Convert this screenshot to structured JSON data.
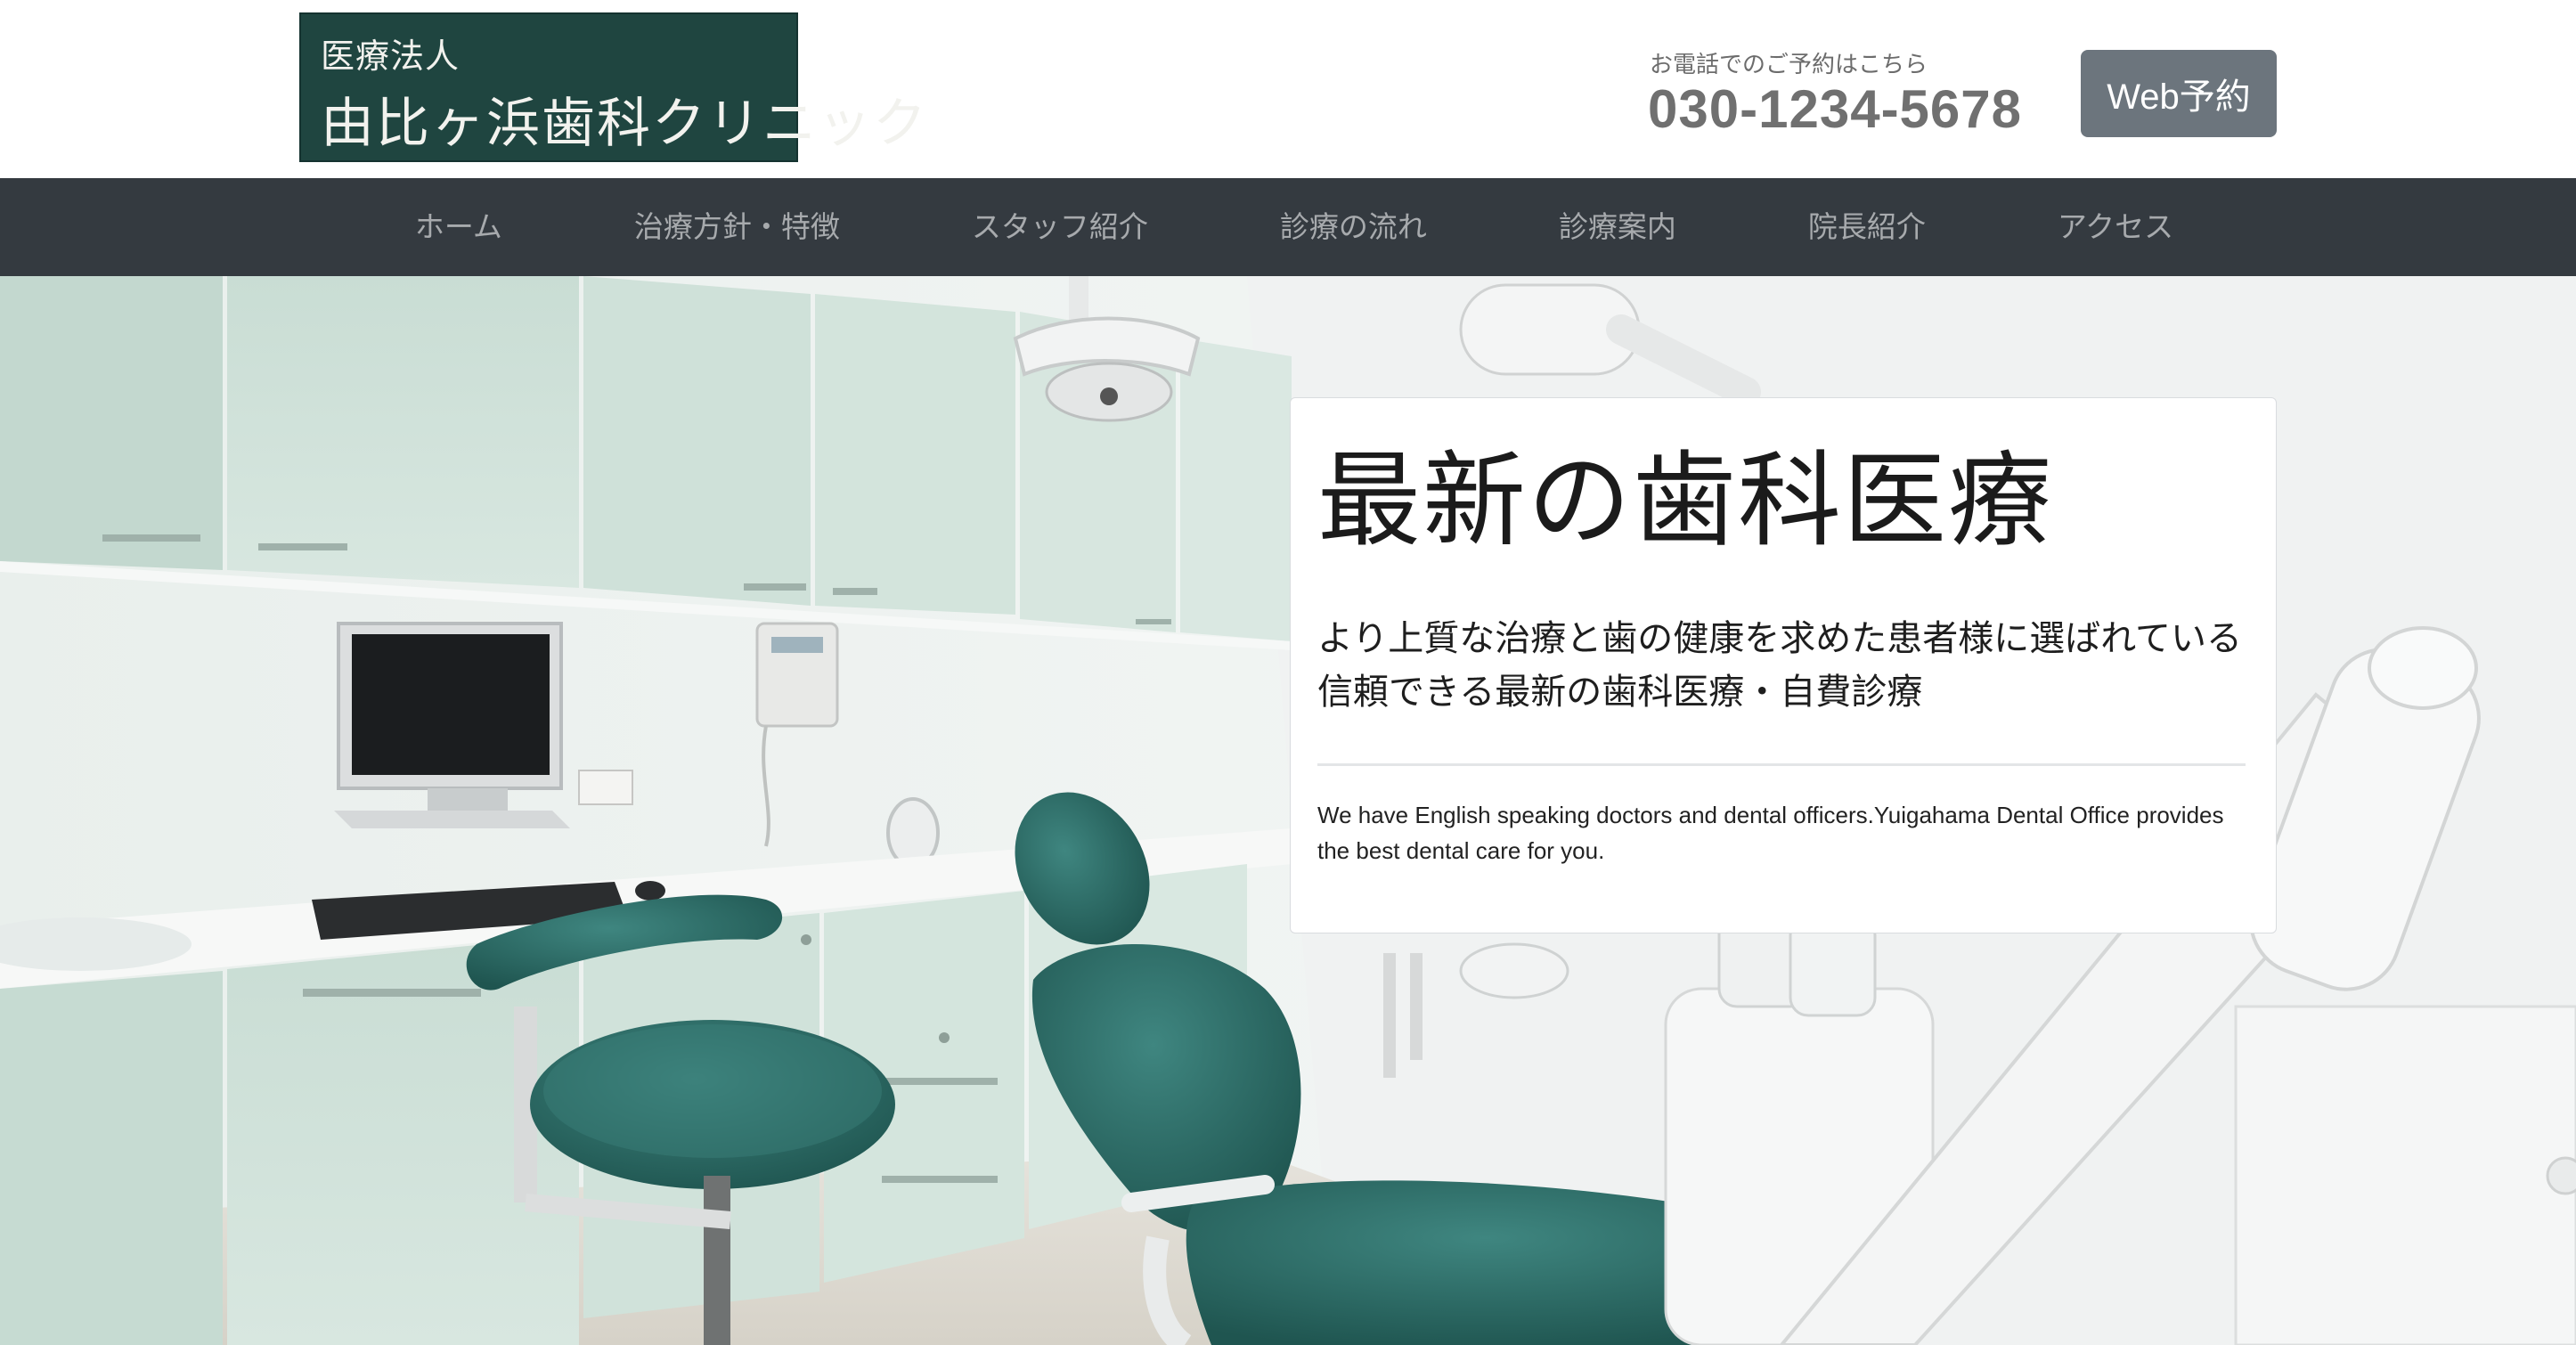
{
  "header": {
    "logo_subtitle": "医療法人",
    "logo_title": "由比ヶ浜歯科クリニック",
    "phone_caption": "お電話でのご予約はこちら",
    "phone_number": "030-1234-5678",
    "web_reserve_label": "Web予約"
  },
  "nav": {
    "items": [
      {
        "label": "ホーム"
      },
      {
        "label": "治療方針・特徴"
      },
      {
        "label": "スタッフ紹介"
      },
      {
        "label": "診療の流れ"
      },
      {
        "label": "診療案内"
      },
      {
        "label": "院長紹介"
      },
      {
        "label": "アクセス"
      }
    ]
  },
  "hero": {
    "title": "最新の歯科医療",
    "lead_line1": "より上質な治療と歯の健康を求めた患者様に選ばれている",
    "lead_line2": "信頼できる最新の歯科医療・自費診療",
    "body": "We have English speaking doctors and dental officers.Yuigahama Dental Office provides the best dental care for you."
  },
  "colors": {
    "logo_bg": "#1f4540",
    "nav_bg": "#343a40",
    "button_bg": "#6c757d",
    "chair_teal": "#2e6b66"
  }
}
